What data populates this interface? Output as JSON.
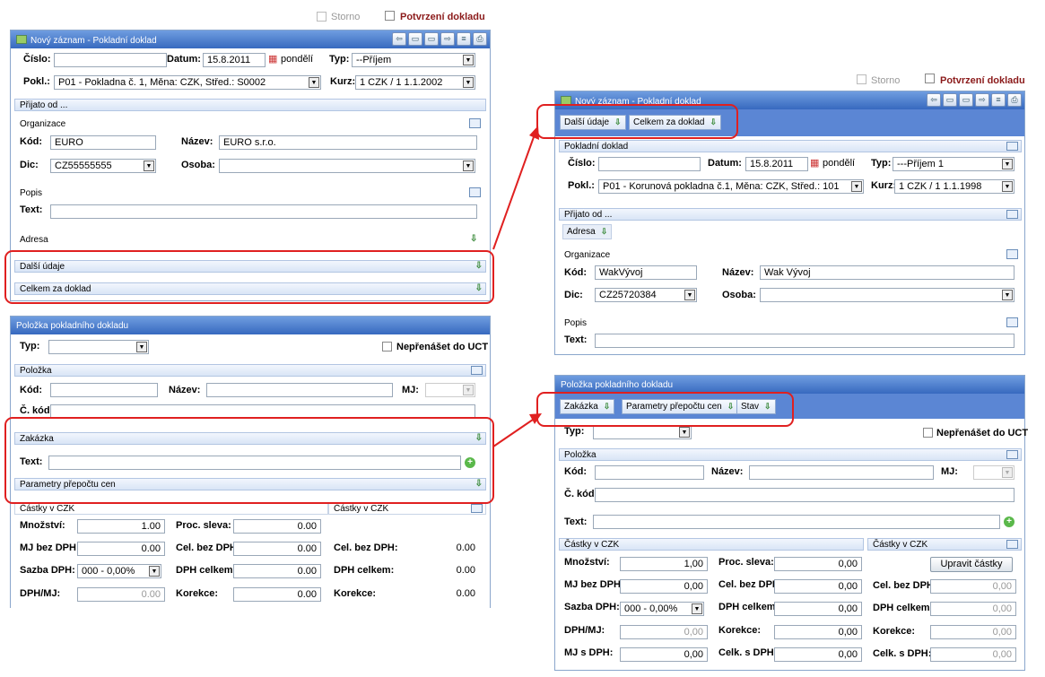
{
  "left_top": {
    "storno": "Storno",
    "potvrzeni": "Potvrzení dokladu",
    "title": "Nový záznam - Pokladní doklad",
    "cislo_lbl": "Číslo:",
    "datum_lbl": "Datum:",
    "datum_val": "15.8.2011",
    "day": "pondělí",
    "typ_lbl": "Typ:",
    "typ_val": "--Příjem",
    "pokl_lbl": "Pokl.:",
    "pokl_val": "P01 - Pokladna č. 1, Měna: CZK, Střed.: S0002",
    "kurz_lbl": "Kurz:",
    "kurz_val": "1 CZK / 1 1.1.2002",
    "prijato": "Přijato od ...",
    "organizace": "Organizace",
    "kod_lbl": "Kód:",
    "kod_val": "EURO",
    "nazev_lbl": "Název:",
    "nazev_val": "EURO s.r.o.",
    "dic_lbl": "Dic:",
    "dic_val": "CZ55555555",
    "osoba_lbl": "Osoba:",
    "popis": "Popis",
    "text_lbl": "Text:",
    "adresa": "Adresa",
    "dalsi": "Další údaje",
    "celkem": "Celkem za doklad"
  },
  "left_bot": {
    "title": "Položka pokladního dokladu",
    "typ_lbl": "Typ:",
    "neprenaset": "Nepřenášet do UCT",
    "polozka": "Položka",
    "kod_lbl": "Kód:",
    "nazev_lbl": "Název:",
    "mj_lbl": "MJ:",
    "ckod_lbl": "Č. kód:",
    "zakazka": "Zakázka",
    "text_lbl": "Text:",
    "parametry": "Parametry přepočtu cen",
    "castky1": "Částky v CZK",
    "castky2": "Částky v CZK",
    "mnozstvi_lbl": "Množství:",
    "mnozstvi_val": "1.00",
    "procsleva_lbl": "Proc. sleva:",
    "procsleva_val": "0.00",
    "mjbez_lbl": "MJ bez DPH:",
    "mjbez_val": "0.00",
    "celbez_lbl": "Cel. bez DPH",
    "celbez_val": "0.00",
    "sazba_lbl": "Sazba DPH:",
    "sazba_val": "000 - 0,00%",
    "dphcelkem_lbl": "DPH celkem:",
    "dphcelkem_val": "0.00",
    "dphmj_lbl": "DPH/MJ:",
    "dphmj_val": "0.00",
    "korekce_lbl": "Korekce:",
    "korekce_val": "0.00",
    "r_celbez_lbl": "Cel. bez DPH:",
    "r_celbez_val": "0.00",
    "r_dph_lbl": "DPH celkem:",
    "r_dph_val": "0.00",
    "r_kor_lbl": "Korekce:",
    "r_kor_val": "0.00"
  },
  "right_top": {
    "storno": "Storno",
    "potvrzeni": "Potvrzení dokladu",
    "title": "Nový záznam - Pokladní doklad",
    "dalsi": "Další údaje",
    "celkem": "Celkem za doklad",
    "pokladni": "Pokladní doklad",
    "cislo_lbl": "Číslo:",
    "datum_lbl": "Datum:",
    "datum_val": "15.8.2011",
    "day": "pondělí",
    "typ_lbl": "Typ:",
    "typ_val": "---Příjem 1",
    "pokl_lbl": "Pokl.:",
    "pokl_val": "P01 - Korunová pokladna č.1, Měna: CZK, Střed.: 101",
    "kurz_lbl": "Kurz:",
    "kurz_val": "1 CZK / 1 1.1.1998",
    "prijato": "Přijato od ...",
    "adresa": "Adresa",
    "organizace": "Organizace",
    "kod_lbl": "Kód:",
    "kod_val": "WakVývoj",
    "nazev_lbl": "Název:",
    "nazev_val": "Wak Vývoj",
    "dic_lbl": "Dic:",
    "dic_val": "CZ25720384",
    "osoba_lbl": "Osoba:",
    "popis": "Popis",
    "text_lbl": "Text:"
  },
  "right_bot": {
    "title": "Položka pokladního dokladu",
    "zakazka": "Zakázka",
    "parametry": "Parametry přepočtu cen",
    "stav": "Stav",
    "typ_lbl": "Typ:",
    "neprenaset": "Nepřenášet do UCT",
    "polozka": "Položka",
    "kod_lbl": "Kód:",
    "nazev_lbl": "Název:",
    "mj_lbl": "MJ:",
    "ckod_lbl": "Č. kód:",
    "text_lbl": "Text:",
    "castky1": "Částky v CZK",
    "castky2": "Částky v CZK",
    "upravit": "Upravit částky",
    "mnozstvi_lbl": "Množství:",
    "mnozstvi_val": "1,00",
    "procsleva_lbl": "Proc. sleva:",
    "procsleva_val": "0,00",
    "mjbez_lbl": "MJ bez DPH:",
    "mjbez_val": "0,00",
    "celbez_lbl": "Cel. bez DPH",
    "celbez_val": "0,00",
    "sazba_lbl": "Sazba DPH:",
    "sazba_val": "000 - 0,00%",
    "dph_lbl": "DPH celkem:",
    "dph_val": "0,00",
    "dphmj_lbl": "DPH/MJ:",
    "dphmj_val": "0,00",
    "korekce_lbl": "Korekce:",
    "korekce_val": "0,00",
    "mjs_lbl": "MJ s DPH:",
    "mjs_val": "0,00",
    "celks_lbl": "Celk. s DPH:",
    "celks_val": "0,00",
    "r_celbez_lbl": "Cel. bez DPH",
    "r_celbez_val": "0,00",
    "r_dph_lbl": "DPH celkem:",
    "r_dph_val": "0,00",
    "r_kor_lbl": "Korekce:",
    "r_kor_val": "0,00",
    "r_celks_lbl": "Celk. s DPH:",
    "r_celks_val": "0,00"
  },
  "colors": {
    "accent": "#3769bf",
    "highlight": "#e02020",
    "bar": "#5b86d4"
  }
}
